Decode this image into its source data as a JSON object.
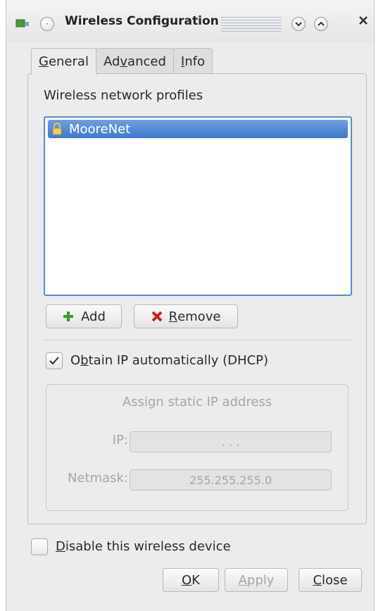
{
  "window": {
    "title": "Wireless Configuration"
  },
  "tabs": [
    {
      "prefix": "",
      "mnemonic": "G",
      "rest": "eneral"
    },
    {
      "prefix": "Ad",
      "mnemonic": "v",
      "rest": "anced"
    },
    {
      "prefix": "",
      "mnemonic": "I",
      "rest": "nfo"
    }
  ],
  "general": {
    "profiles_label": "Wireless network profiles",
    "profiles": [
      {
        "name": "MooreNet"
      }
    ],
    "add_label": "Add",
    "remove_mnemonic": "R",
    "remove_rest": "emove",
    "dhcp": {
      "prefix": "O",
      "mnemonic": "b",
      "rest": "tain IP automatically (DHCP)",
      "checked": true
    },
    "static_group": {
      "title": "Assign static IP address",
      "ip_label": "IP:",
      "ip_value": ". . .",
      "netmask_label": "Netmask:",
      "netmask_value": "255.255.255.0"
    }
  },
  "disable_device": {
    "mnemonic": "D",
    "rest": "isable this wireless device",
    "checked": false
  },
  "buttons": {
    "ok_mnemonic": "O",
    "ok_rest": "K",
    "apply_mnemonic": "A",
    "apply_rest": "pply",
    "close_mnemonic": "C",
    "close_rest": "lose"
  },
  "colors": {
    "selection": "#3f78cf",
    "add_green": "#3a9a2a",
    "remove_red": "#cc2020"
  }
}
